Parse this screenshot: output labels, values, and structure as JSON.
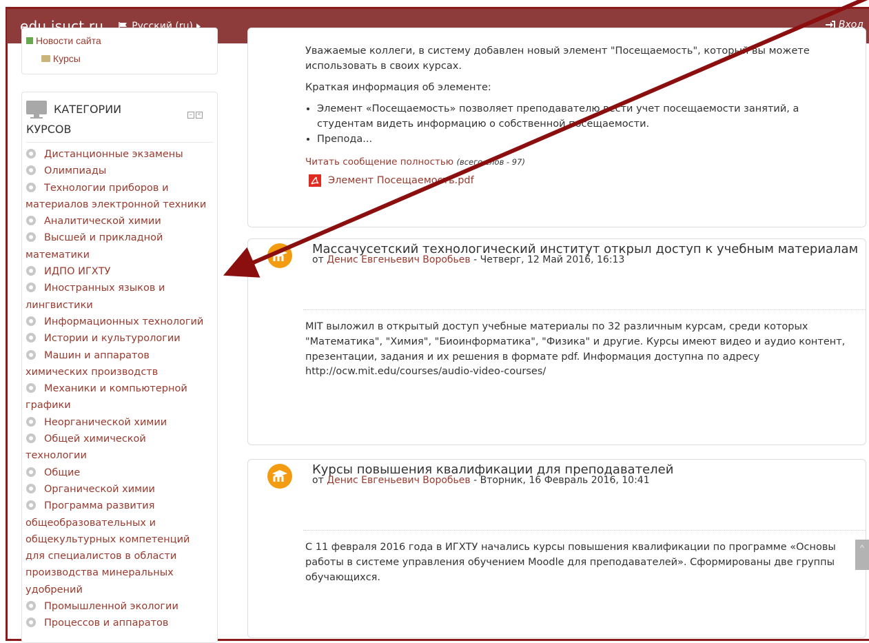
{
  "header": {
    "brand": "edu.isuct.ru",
    "language": "Русский (ru)",
    "login": "Вход"
  },
  "left_nav": {
    "news": "Новости сайта",
    "courses": "Курсы"
  },
  "categories": {
    "title_line1": "КАТЕГОРИИ",
    "title_line2": "КУРСОВ",
    "items": [
      {
        "label": "Дистанционные экзамены"
      },
      {
        "label": "Олимпиады"
      },
      {
        "label": "Технологии приборов и",
        "label2": "материалов электронной техники"
      },
      {
        "label": "Аналитической химии"
      },
      {
        "label": "Высшей и прикладной",
        "label2": "математики"
      },
      {
        "label": "ИДПО ИГХТУ"
      },
      {
        "label": "Иностранных языков и",
        "label2": "лингвистики"
      },
      {
        "label": "Информационных технологий"
      },
      {
        "label": "Истории и культурологии"
      },
      {
        "label": "Машин и аппаратов",
        "label2": "химических производств"
      },
      {
        "label": "Механики и компьютерной",
        "label2": "графики"
      },
      {
        "label": "Неорганической химии"
      },
      {
        "label": "Общей химической",
        "label2": "технологии"
      },
      {
        "label": "Общие"
      },
      {
        "label": "Органической химии"
      },
      {
        "label": "Программа развития",
        "label2": "общеобразовательных и",
        "label3": "общекультурных компетенций",
        "label4": "для специалистов в области",
        "label5": "производства минеральных",
        "label6": "удобрений"
      },
      {
        "label": "Промышленной экологии"
      },
      {
        "label": "Процессов и аппаратов"
      }
    ]
  },
  "post1": {
    "line1": "Уважаемые коллеги, в систему добавлен новый элемент \"Посещаемость\", который вы можете",
    "line2": "использовать в своих курсах.",
    "brief": "Краткая информация об элементе:",
    "bullet1_line1": "Элемент «Посещаемость» позволяет преподавателю вести учет посещаемости занятий, а",
    "bullet1_line2": "студентам видеть информацию о собственной посещаемости.",
    "bullet2": "Препода...",
    "read_more": "Читать сообщение полностью",
    "word_count": "(всего слов - 97)",
    "attachment": "Элемент Посещаемость.pdf"
  },
  "post2": {
    "title": "Массачусетский технологический институт открыл доступ к учебным материалам",
    "by_prefix": "от",
    "author": "Денис Евгеньевич Воробьев",
    "date": "- Четверг, 12 Май 2016, 16:13",
    "body_line1": "MIT выложил в открытый доступ учебные материалы по 32 различным курсам, среди которых",
    "body_line2": "\"Математика\", \"Химия\", \"Биоинформатика\", \"Физика\" и другие. Курсы имеют видео и аудио контент,",
    "body_line3": "презентации, задания и их решения в формате pdf. Информация доступна по адресу",
    "link": "http://ocw.mit.edu/courses/audio-video-courses/"
  },
  "post3": {
    "title": "Курсы повышения квалификации для преподавателей",
    "by_prefix": "от",
    "author": "Денис Евгеньевич Воробьев",
    "date": "- Вторник, 16 Февраль 2016, 10:41",
    "body_line1": "С 11 февраля 2016 года в ИГХТУ начались курсы повышения квалификации по программе «Основы",
    "body_line2": "работы в системе управления обучением Moodle для преподавателей». Сформированы две группы",
    "body_line3": "обучающихся."
  },
  "colors": {
    "header_bg": "#8d3b3b",
    "link": "#993a2e",
    "frame": "#8b1a1a",
    "avatar": "#f39c12"
  }
}
